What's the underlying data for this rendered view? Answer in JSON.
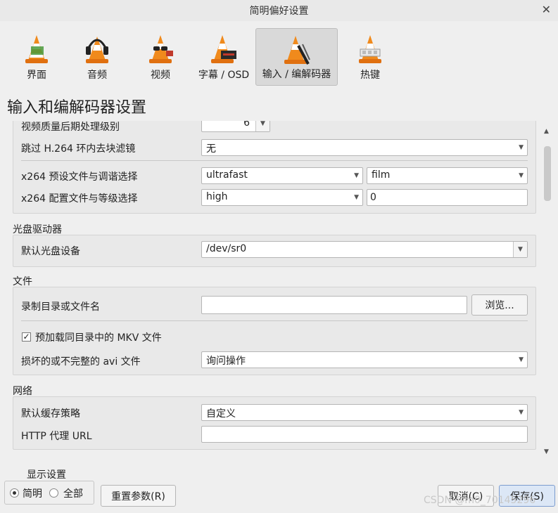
{
  "window": {
    "title": "简明偏好设置"
  },
  "toolbar": {
    "items": [
      {
        "label": "界面",
        "icon": "cone-interface-icon"
      },
      {
        "label": "音频",
        "icon": "cone-headphones-icon"
      },
      {
        "label": "视频",
        "icon": "cone-glasses-icon"
      },
      {
        "label": "字幕 / OSD",
        "icon": "cone-subtitle-icon"
      },
      {
        "label": "输入 / 编解码器",
        "icon": "cone-codec-icon",
        "active": true
      },
      {
        "label": "热键",
        "icon": "cone-hotkeys-icon"
      }
    ]
  },
  "page": {
    "title": "输入和编解码器设置"
  },
  "codecs": {
    "partial_label": "视频质量后期处理级别",
    "partial_value": "6",
    "skip_loop_filter_label": "跳过 H.264 环内去块滤镜",
    "skip_loop_filter_value": "无",
    "x264_preset_label": "x264 预设文件与调谐选择",
    "x264_preset_value": "ultrafast",
    "x264_tune_value": "film",
    "x264_profile_label": "x264 配置文件与等级选择",
    "x264_profile_value": "high",
    "x264_level_value": "0"
  },
  "optical": {
    "group_label": "光盘驱动器",
    "device_label": "默认光盘设备",
    "device_value": "/dev/sr0"
  },
  "files": {
    "group_label": "文件",
    "record_label": "录制目录或文件名",
    "record_value": "",
    "browse_label": "浏览...",
    "mkv_label": "预加载同目录中的 MKV 文件",
    "mkv_checked": true,
    "avi_label": "损坏的或不完整的 avi 文件",
    "avi_value": "询问操作"
  },
  "network": {
    "group_label": "网络",
    "cache_label": "默认缓存策略",
    "cache_value": "自定义",
    "proxy_label": "HTTP 代理 URL",
    "proxy_value": ""
  },
  "footer": {
    "show_settings_label": "显示设置",
    "simple_label": "简明",
    "all_label": "全部",
    "reset_label": "重置参数(R)",
    "cancel_label": "取消(C)",
    "save_label": "保存(S)",
    "watermark": "CSDN @m0_70145296"
  }
}
